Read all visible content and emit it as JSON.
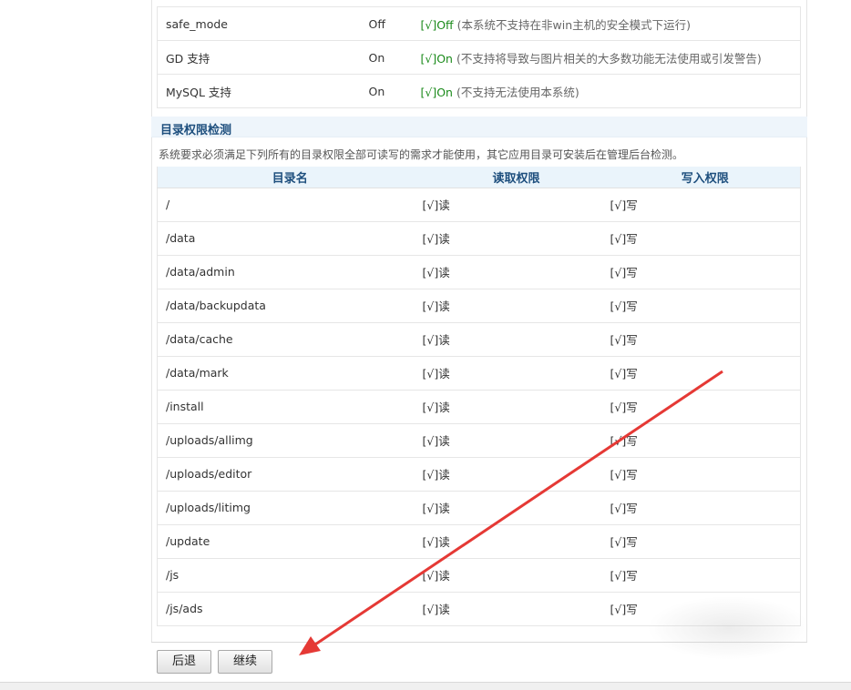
{
  "env_checks": [
    {
      "name": "safe_mode",
      "value": "Off",
      "status": "[√]Off",
      "note": "(本系统不支持在非win主机的安全模式下运行)"
    },
    {
      "name": "GD 支持",
      "value": "On",
      "status": "[√]On",
      "note": "(不支持将导致与图片相关的大多数功能无法使用或引发警告)"
    },
    {
      "name": "MySQL 支持",
      "value": "On",
      "status": "[√]On",
      "note": "(不支持无法使用本系统)"
    }
  ],
  "dir_section": {
    "title": "目录权限检测",
    "description": "系统要求必须满足下列所有的目录权限全部可读写的需求才能使用，其它应用目录可安装后在管理后台检测。",
    "headers": {
      "dir": "目录名",
      "read": "读取权限",
      "write": "写入权限"
    },
    "rows": [
      {
        "dir": "/",
        "read": "[√]读",
        "write": "[√]写"
      },
      {
        "dir": "/data",
        "read": "[√]读",
        "write": "[√]写"
      },
      {
        "dir": "/data/admin",
        "read": "[√]读",
        "write": "[√]写"
      },
      {
        "dir": "/data/backupdata",
        "read": "[√]读",
        "write": "[√]写"
      },
      {
        "dir": "/data/cache",
        "read": "[√]读",
        "write": "[√]写"
      },
      {
        "dir": "/data/mark",
        "read": "[√]读",
        "write": "[√]写"
      },
      {
        "dir": "/install",
        "read": "[√]读",
        "write": "[√]写"
      },
      {
        "dir": "/uploads/allimg",
        "read": "[√]读",
        "write": "[√]写"
      },
      {
        "dir": "/uploads/editor",
        "read": "[√]读",
        "write": "[√]写"
      },
      {
        "dir": "/uploads/litimg",
        "read": "[√]读",
        "write": "[√]写"
      },
      {
        "dir": "/update",
        "read": "[√]读",
        "write": "[√]写"
      },
      {
        "dir": "/js",
        "read": "[√]读",
        "write": "[√]写"
      },
      {
        "dir": "/js/ads",
        "read": "[√]读",
        "write": "[√]写"
      }
    ]
  },
  "buttons": {
    "back": "后退",
    "next": "继续"
  },
  "colors": {
    "ok": "#1a8a1a",
    "header_text": "#1e4f7e",
    "header_bg": "#eaf4fb",
    "arrow": "#e53935"
  }
}
